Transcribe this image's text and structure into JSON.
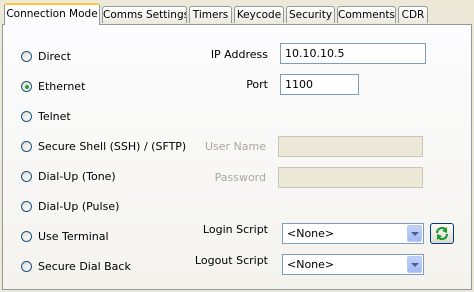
{
  "tabs": [
    {
      "label": "Connection Mode",
      "active": true
    },
    {
      "label": "Comms Settings",
      "active": false
    },
    {
      "label": "Timers",
      "active": false
    },
    {
      "label": "Keycode",
      "active": false
    },
    {
      "label": "Security",
      "active": false
    },
    {
      "label": "Comments",
      "active": false
    },
    {
      "label": "CDR",
      "active": false
    }
  ],
  "modes": [
    {
      "label": "Direct",
      "checked": false
    },
    {
      "label": "Ethernet",
      "checked": true
    },
    {
      "label": "Telnet",
      "checked": false
    },
    {
      "label": "Secure Shell (SSH) / (SFTP)",
      "checked": false
    },
    {
      "label": "Dial-Up (Tone)",
      "checked": false
    },
    {
      "label": "Dial-Up (Pulse)",
      "checked": false
    },
    {
      "label": "Use Terminal",
      "checked": false
    },
    {
      "label": "Secure Dial Back",
      "checked": false
    }
  ],
  "fields": {
    "ip_label": "IP Address",
    "ip_value": "10.10.10.5",
    "port_label": "Port",
    "port_value": "1100",
    "username_label": "User Name",
    "username_value": "",
    "password_label": "Password",
    "password_value": "",
    "login_label": "Login Script",
    "login_value": "<None>",
    "logout_label": "Logout Script",
    "logout_value": "<None>"
  },
  "colors": {
    "active_tab_accent": "#ffc83c",
    "radio_check": "#21a121",
    "refresh_icon": "#1e9a2f"
  },
  "icons": {
    "refresh": "refresh-icon"
  }
}
